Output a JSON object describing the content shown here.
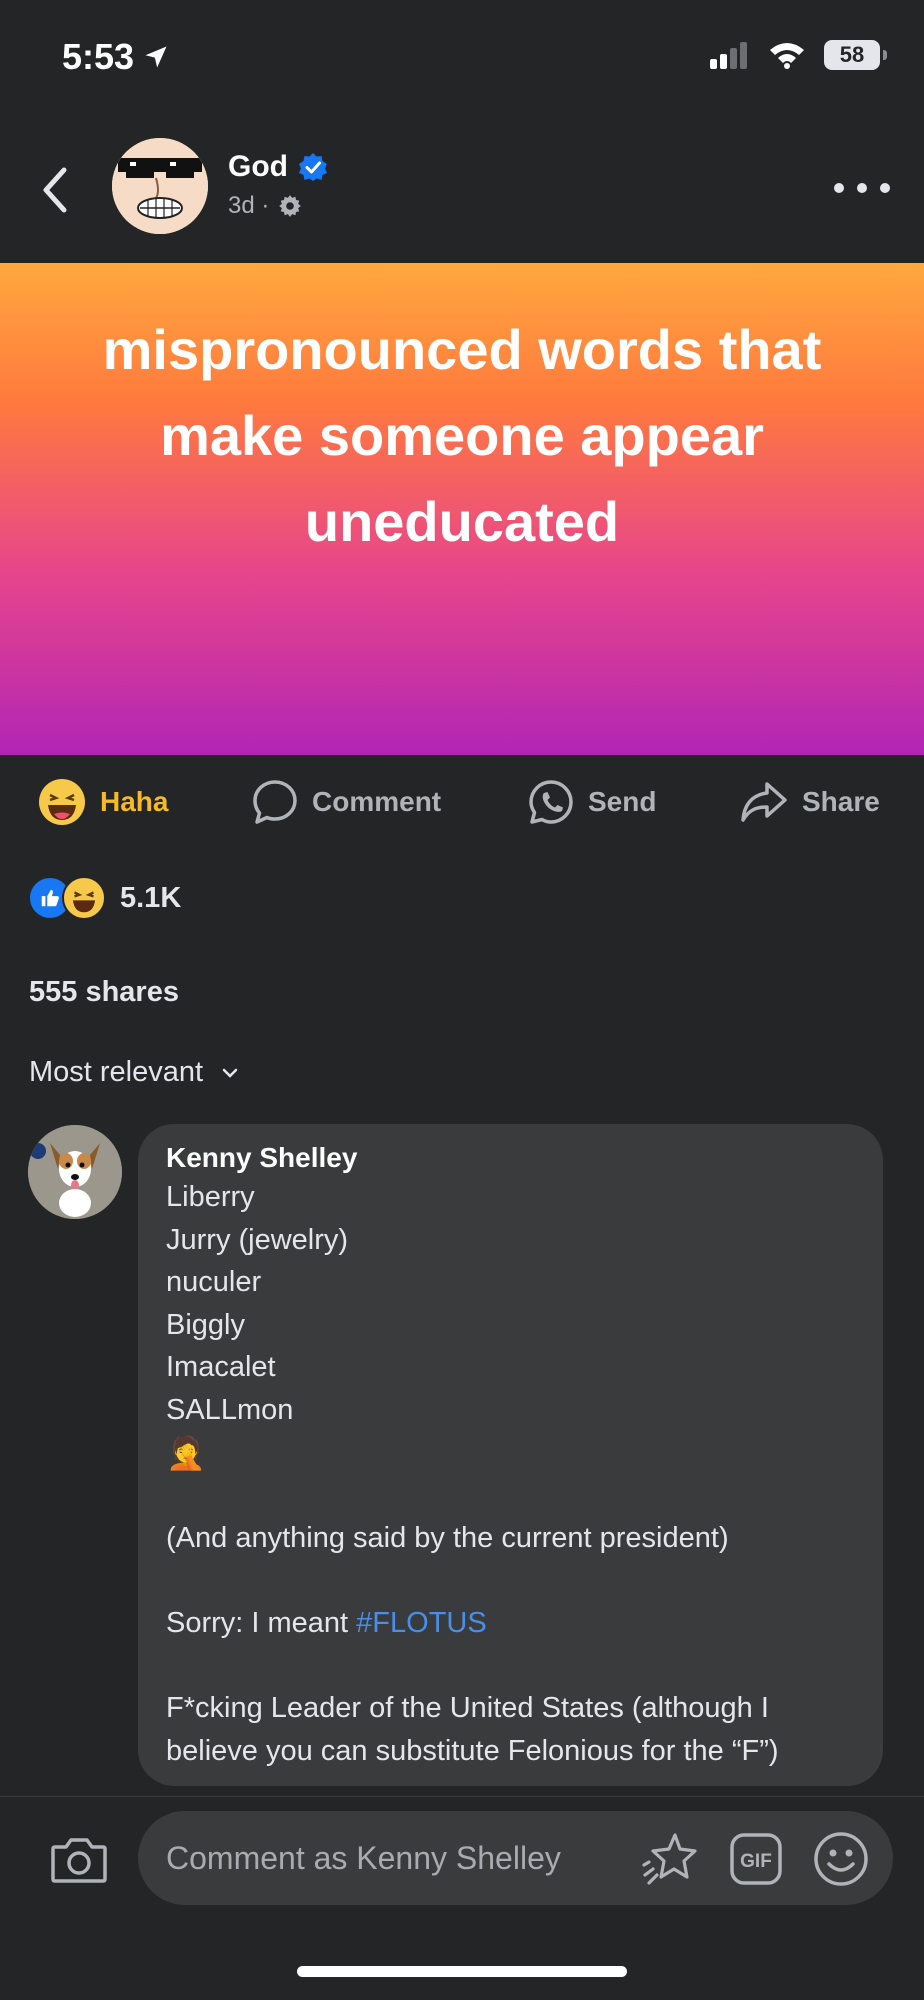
{
  "status_bar": {
    "time": "5:53",
    "battery": "58"
  },
  "post": {
    "author": "God",
    "meta": "3d ·",
    "text": "mispronounced words that make someone appear uneducated"
  },
  "actions": {
    "haha": "Haha",
    "comment": "Comment",
    "send": "Send",
    "share": "Share"
  },
  "stats": {
    "reaction_count": "5.1K",
    "shares": "555 shares"
  },
  "sort": {
    "label": "Most relevant"
  },
  "comment": {
    "author": "Kenny Shelley",
    "lines": [
      "Liberry",
      "Jurry (jewelry)",
      "nuculer",
      "Biggly",
      "Imacalet",
      "SALLmon",
      "🤦",
      "",
      "(And anything said by the current president)",
      "",
      "Sorry: I meant "
    ],
    "hashtag": "#FLOTUS",
    "after": [
      "",
      "F*cking Leader of the United States (although I",
      "believe you can substitute Felonious for the “F”)"
    ]
  },
  "composer": {
    "placeholder": "Comment as Kenny Shelley",
    "gif_label": "GIF"
  },
  "colors": {
    "background": "#242526",
    "bubble": "#3a3b3c",
    "haha": "#f7b928",
    "verified": "#1877f2",
    "hashtag": "#4b8ee8"
  }
}
